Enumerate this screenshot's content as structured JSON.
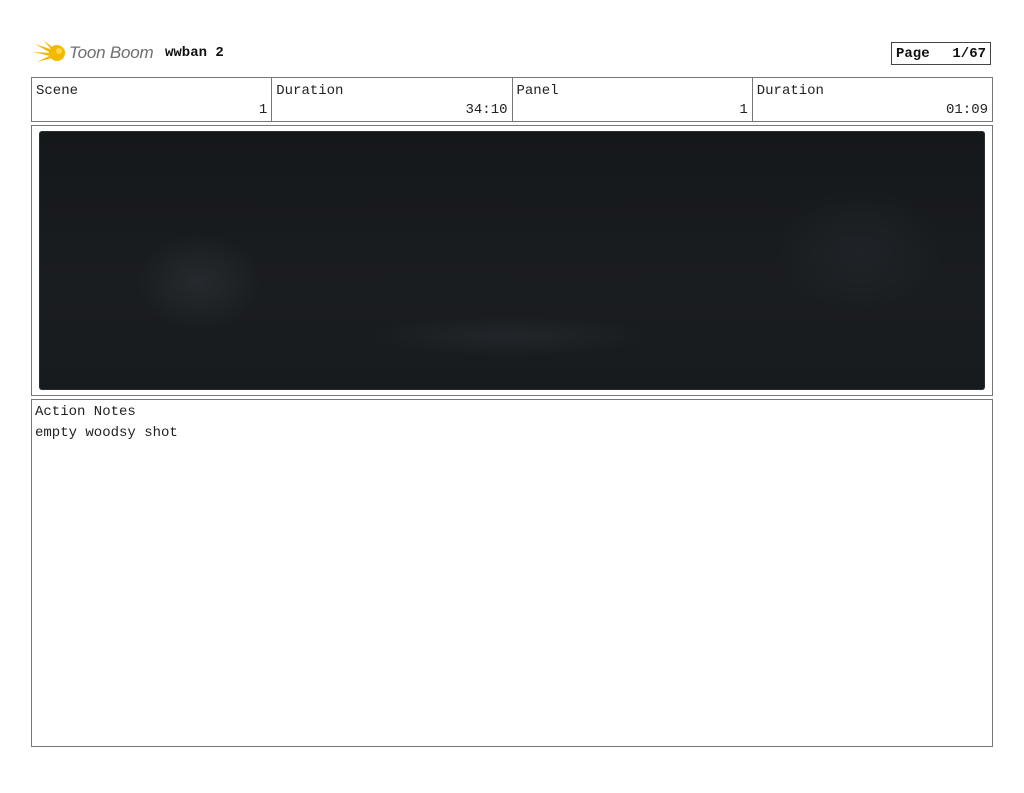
{
  "header": {
    "logo_text": "Toon Boom",
    "project_title": "wwban 2",
    "page_label": "Page",
    "page_number": "1/67"
  },
  "info": {
    "scene_label": "Scene",
    "scene_value": "1",
    "scene_duration_label": "Duration",
    "scene_duration_value": "34:10",
    "panel_label": "Panel",
    "panel_value": "1",
    "panel_duration_label": "Duration",
    "panel_duration_value": "01:09"
  },
  "notes": {
    "label": "Action Notes",
    "text": "empty woodsy shot"
  },
  "colors": {
    "logo_yellow": "#f5b800",
    "panel_dark": "#181b1e"
  },
  "icons": {
    "logo": "toon-boom-burst-icon"
  }
}
